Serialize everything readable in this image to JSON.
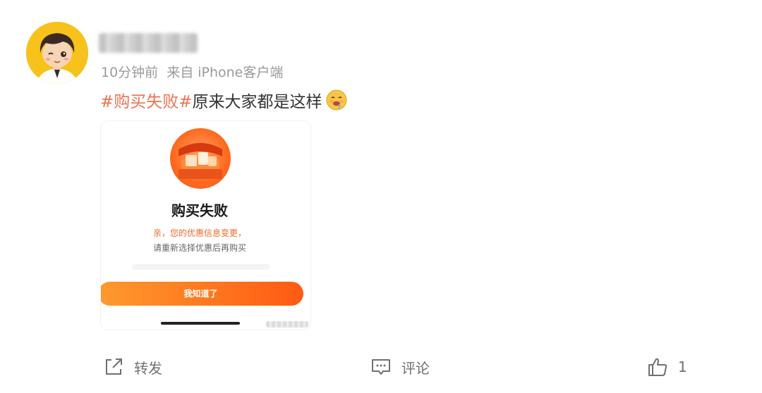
{
  "post": {
    "time": "10分钟前",
    "source": "来自 iPhone客户端",
    "topic": "#购买失败#",
    "text": "原来大家都是这样",
    "emoji_icon": "drooling-face-icon",
    "avatar_icon": "cartoon-boy-avatar"
  },
  "embedded_screenshot": {
    "title": "购买失败",
    "line1": "亲，您的优惠信息变更，",
    "line2": "请重新选择优惠后再购买",
    "button_label": "我知道了",
    "accent_color": "#ff6a1f"
  },
  "actions": {
    "repost_label": "转发",
    "comment_label": "评论",
    "like_count": "1"
  },
  "colors": {
    "topic": "#eb7350",
    "meta_text": "#9b9b9b",
    "avatar_bg": "#f6c21b"
  }
}
